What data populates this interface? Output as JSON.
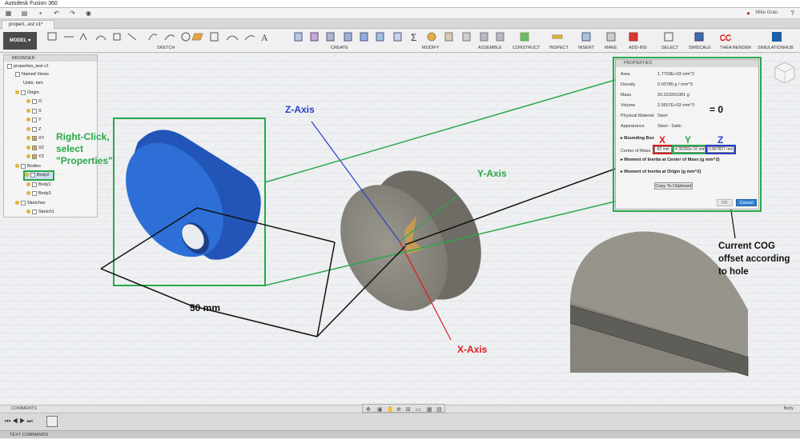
{
  "window": {
    "title": "Autodesk Fusion 360",
    "user": "Mike Grau"
  },
  "document_tab": {
    "label": "propert...est v1*"
  },
  "ribbon": {
    "workspace": "MODEL",
    "groups": [
      "SKETCH",
      "CREATE",
      "MODIFY",
      "ASSEMBLE",
      "CONSTRUCT",
      "INSPECT",
      "INSERT",
      "MAKE",
      "ADD-INS",
      "SELECT",
      "SIMSCALE",
      "THEA RENDER",
      "SIMULATIONHUB"
    ]
  },
  "browser": {
    "title": "BROWSER",
    "items": [
      {
        "label": "properties_test v1",
        "depth": 0,
        "kind": "root"
      },
      {
        "label": "Named Views",
        "depth": 1,
        "kind": "folder"
      },
      {
        "label": "Units: mm",
        "depth": 1,
        "kind": "doc"
      },
      {
        "label": "Origin",
        "depth": 1,
        "kind": "folder"
      },
      {
        "label": "O",
        "depth": 2,
        "kind": "origin"
      },
      {
        "label": "X",
        "depth": 2,
        "kind": "axis"
      },
      {
        "label": "Y",
        "depth": 2,
        "kind": "axis"
      },
      {
        "label": "Z",
        "depth": 2,
        "kind": "axis"
      },
      {
        "label": "XY",
        "depth": 2,
        "kind": "plane"
      },
      {
        "label": "XZ",
        "depth": 2,
        "kind": "plane"
      },
      {
        "label": "YZ",
        "depth": 2,
        "kind": "plane"
      },
      {
        "label": "Bodies",
        "depth": 1,
        "kind": "folder"
      },
      {
        "label": "Body2",
        "depth": 2,
        "kind": "body",
        "selected": true
      },
      {
        "label": "Body1",
        "depth": 2,
        "kind": "body"
      },
      {
        "label": "Body3",
        "depth": 2,
        "kind": "body"
      },
      {
        "label": "Sketches",
        "depth": 1,
        "kind": "folder"
      },
      {
        "label": "Sketch1",
        "depth": 2,
        "kind": "sketch"
      }
    ]
  },
  "properties": {
    "title": "PROPERTIES",
    "rows": [
      {
        "label": "Area",
        "value": "1.7703E+03 mm^2"
      },
      {
        "label": "Density",
        "value": "0.00785 g / mm^3"
      },
      {
        "label": "Mass",
        "value": "20.023261981 g"
      },
      {
        "label": "Volume",
        "value": "2.5507E+03 mm^3"
      },
      {
        "label": "Physical Material",
        "value": "Steel"
      },
      {
        "label": "Appearance",
        "value": "Steel - Satin"
      }
    ],
    "bounding_box": "Bounding Box",
    "center_of_mass_label": "Center of Mass",
    "com_x": "-50 mm",
    "com_y": "4.35256e-16 mm",
    "com_z": "0.867827 mm",
    "moi_center": "Moment of Inertia at Center of Mass   (g mm^2)",
    "moi_origin": "Moment of Inertia at Origin   (g mm^2)",
    "copy_button": "Copy To Clipboard",
    "ok_button": "OK",
    "cancel_button": "Cancel"
  },
  "annotations": {
    "right_click": [
      "Right-Click,",
      "select",
      "\"Properties\""
    ],
    "z_axis": "Z-Axis",
    "y_axis": "Y-Axis",
    "x_axis": "X-Axis",
    "dimension": "50 mm",
    "equals_zero": "= 0",
    "x_letter": "X",
    "y_letter": "Y",
    "z_letter": "Z",
    "cog_note": [
      "Current COG",
      "offset according",
      "to hole"
    ]
  },
  "status": {
    "comments": "COMMENTS",
    "right_text": "Body"
  },
  "text_commands": "TEXT COMMANDS",
  "colors": {
    "blue_body": "#2d6fd6",
    "steel_body": "#8a8880",
    "annotation_green": "#2aa84a",
    "annotation_red": "#e01b1b",
    "annotation_blue": "#2740c8"
  }
}
